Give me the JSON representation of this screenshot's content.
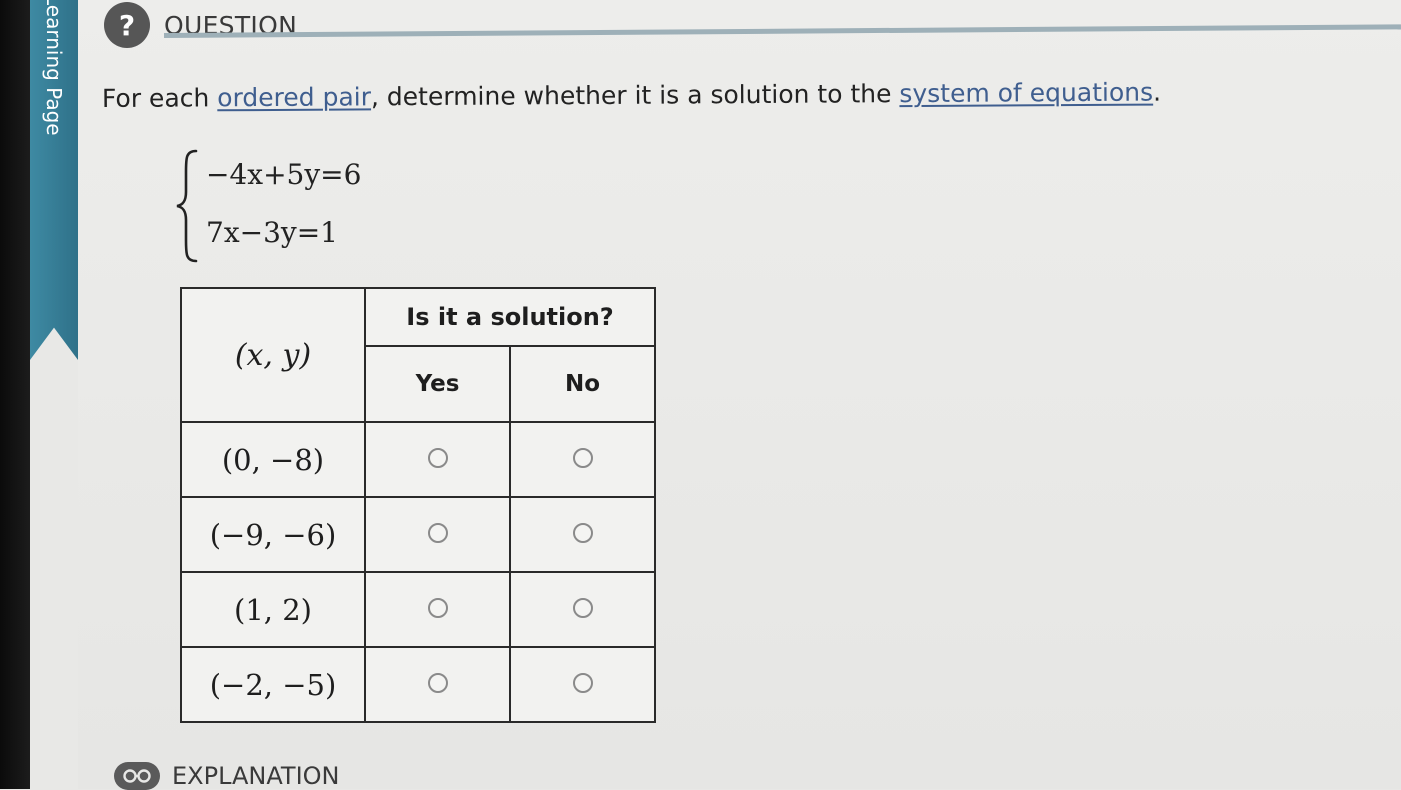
{
  "sidebar": {
    "tab_label": "Learning Page"
  },
  "question": {
    "header_label": "QUESTION",
    "badge": "?",
    "prompt_before": "For each ",
    "link1": "ordered pair",
    "prompt_middle": ", determine whether it is a solution to the ",
    "link2": "system of equations",
    "prompt_after": "."
  },
  "system": {
    "equations": [
      "−4x+5y=6",
      "7x−3y=1"
    ]
  },
  "table": {
    "header_group": "Is it a solution?",
    "pair_header": "(x, y)",
    "yes_label": "Yes",
    "no_label": "No",
    "rows": [
      {
        "pair": "(0, −8)"
      },
      {
        "pair": "(−9, −6)"
      },
      {
        "pair": "(1, 2)"
      },
      {
        "pair": "(−2, −5)"
      }
    ]
  },
  "explanation": {
    "label": "EXPLANATION",
    "icon": "glasses-icon"
  },
  "colors": {
    "accent_tab": "#3e8aa3",
    "link": "#3f5e8f",
    "rule": "#9eb0b8"
  }
}
